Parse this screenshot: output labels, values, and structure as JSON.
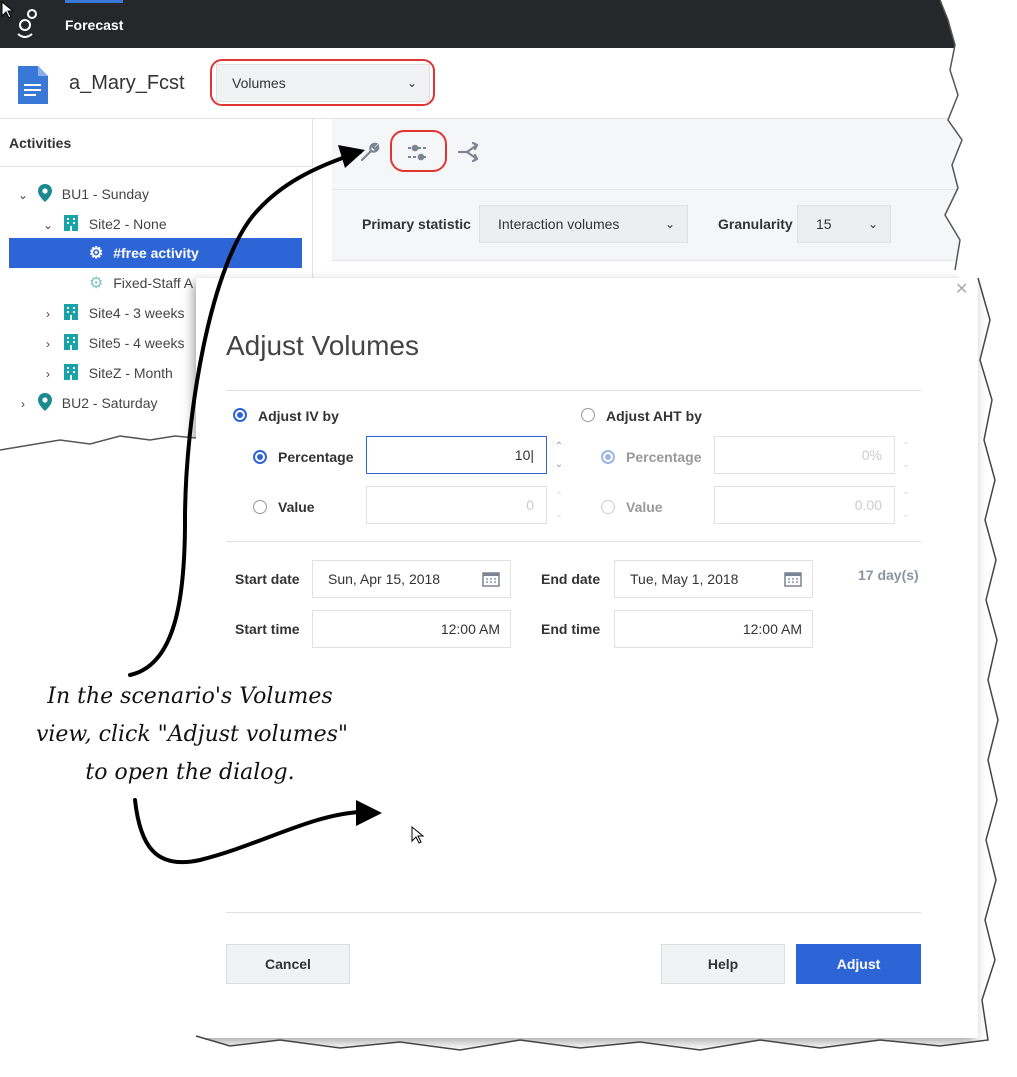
{
  "app": {
    "tab": "Forecast",
    "scenario_name": "a_Mary_Fcst",
    "view_select": "Volumes"
  },
  "sidebar": {
    "title": "Activities",
    "items": [
      {
        "label": "BU1 - Sunday",
        "icon": "location-pin-icon"
      },
      {
        "label": "Site2 - None",
        "icon": "building-icon"
      },
      {
        "label": "#free activity",
        "icon": "gear-icon"
      },
      {
        "label": "Fixed-Staff A",
        "icon": "gear-icon"
      },
      {
        "label": "Site4 - 3 weeks",
        "icon": "building-icon"
      },
      {
        "label": "Site5 - 4 weeks",
        "icon": "building-icon"
      },
      {
        "label": "SiteZ - Month",
        "icon": "building-icon"
      },
      {
        "label": "BU2 - Saturday",
        "icon": "location-pin-icon"
      }
    ]
  },
  "toolbar": {
    "icons": [
      "wrench-icon",
      "adjust-volumes-sliders-icon",
      "share-icon"
    ]
  },
  "stats": {
    "primary_label": "Primary statistic",
    "primary_value": "Interaction volumes",
    "granularity_label": "Granularity",
    "granularity_value": "15"
  },
  "dialog": {
    "title": "Adjust Volumes",
    "adjust_iv_label": "Adjust IV by",
    "adjust_aht_label": "Adjust AHT by",
    "percentage_label": "Percentage",
    "value_label": "Value",
    "iv_percentage": "10",
    "iv_value": "0",
    "aht_percentage": "0%",
    "aht_value": "0.00",
    "start_date_label": "Start date",
    "start_date": "Sun, Apr 15, 2018",
    "end_date_label": "End date",
    "end_date": "Tue, May 1, 2018",
    "days": "17 day(s)",
    "start_time_label": "Start time",
    "start_time": "12:00 AM",
    "end_time_label": "End time",
    "end_time": "12:00 AM",
    "cancel": "Cancel",
    "help": "Help",
    "adjust": "Adjust"
  },
  "annotation": {
    "line1": "In the scenario's Volumes",
    "line2": "view, click \"Adjust volumes\"",
    "line3": "to open the dialog."
  },
  "colors": {
    "accent": "#2e65d6",
    "topbar": "#26272b",
    "highlight": "#e03535"
  }
}
